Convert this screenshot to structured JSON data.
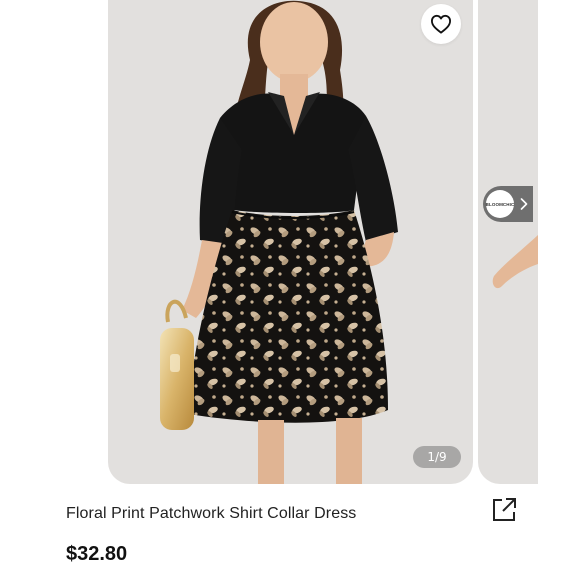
{
  "product": {
    "title": "Floral Print Patchwork Shirt Collar Dress",
    "price": "$32.80"
  },
  "gallery": {
    "counter": "1/9",
    "current_image": 1,
    "total_images": 9,
    "brand_logo_text": "BLOOMCHIC"
  },
  "icons": {
    "favorite": "heart-outline-icon",
    "next": "chevron-right-icon",
    "share": "share-external-icon"
  },
  "colors": {
    "card_background": "#e2e0de",
    "dress_black": "#121212",
    "floral_beige": "#cdb79a",
    "counter_background": "#8a8a8a",
    "price_text": "#111111"
  }
}
